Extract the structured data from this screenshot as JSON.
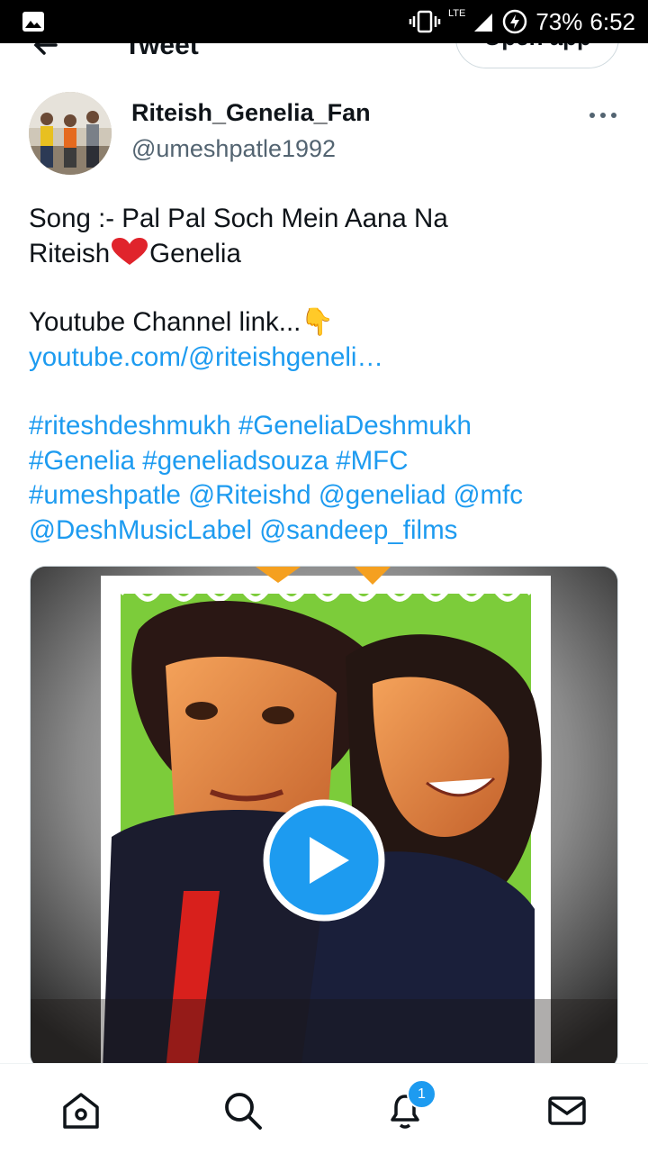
{
  "status_bar": {
    "battery": "73%",
    "time": "6:52",
    "network": "LTE",
    "icons": [
      "gallery-icon",
      "vibrate-icon",
      "signal-icon",
      "battery-saver-icon"
    ]
  },
  "header": {
    "title": "Tweet",
    "open_app_label": "Open app"
  },
  "author": {
    "name": "Riteish_Genelia_Fan",
    "handle": "@umeshpatle1992"
  },
  "tweet": {
    "line1": "Song :- Pal Pal Soch Mein Aana Na",
    "line2_a": "Riteish",
    "line2_b": "Genelia",
    "line3": "Youtube Channel link...",
    "emoji_point": "👇",
    "link": "youtube.com/@riteishgeneli…",
    "hashtags": [
      [
        "#riteshdeshmukh",
        "#GeneliaDeshmukh"
      ],
      [
        "#Genelia",
        "#geneliadsouza",
        "#MFC"
      ],
      [
        "#umeshpatle",
        "@Riteishd",
        "@geneliad",
        "@mfc"
      ],
      [
        "@DeshMusicLabel",
        "@sandeep_films"
      ]
    ]
  },
  "nav": {
    "notification_count": "1",
    "accent_color": "#1d9bf0"
  }
}
